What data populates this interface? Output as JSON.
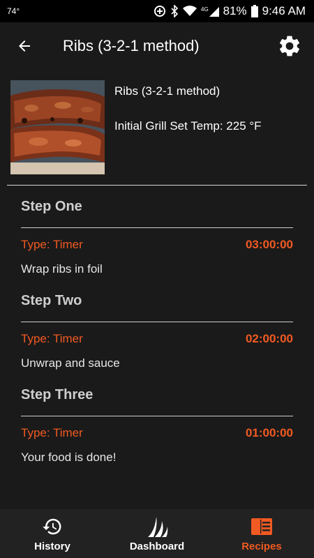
{
  "status_bar": {
    "temperature": "74°",
    "battery": "81%",
    "time": "9:46 AM",
    "network": "4G"
  },
  "app_bar": {
    "title": "Ribs (3-2-1 method)"
  },
  "recipe": {
    "name": "Ribs (3-2-1 method)",
    "grill_temp": "Initial Grill Set Temp: 225 °F"
  },
  "steps": [
    {
      "title": "Step One",
      "type": "Type: Timer",
      "time": "03:00:00",
      "desc": "Wrap ribs in foil"
    },
    {
      "title": "Step Two",
      "type": "Type: Timer",
      "time": "02:00:00",
      "desc": "Unwrap and sauce"
    },
    {
      "title": "Step Three",
      "type": "Type: Timer",
      "time": "01:00:00",
      "desc": "Your food is done!"
    }
  ],
  "bottom_nav": {
    "items": [
      {
        "label": "History",
        "icon": "history-icon",
        "active": false
      },
      {
        "label": "Dashboard",
        "icon": "flame-logo-icon",
        "active": false
      },
      {
        "label": "Recipes",
        "icon": "recipe-book-icon",
        "active": true
      }
    ]
  },
  "colors": {
    "accent": "#f15a22",
    "background": "#1a1a1a",
    "nav_background": "#222222"
  }
}
